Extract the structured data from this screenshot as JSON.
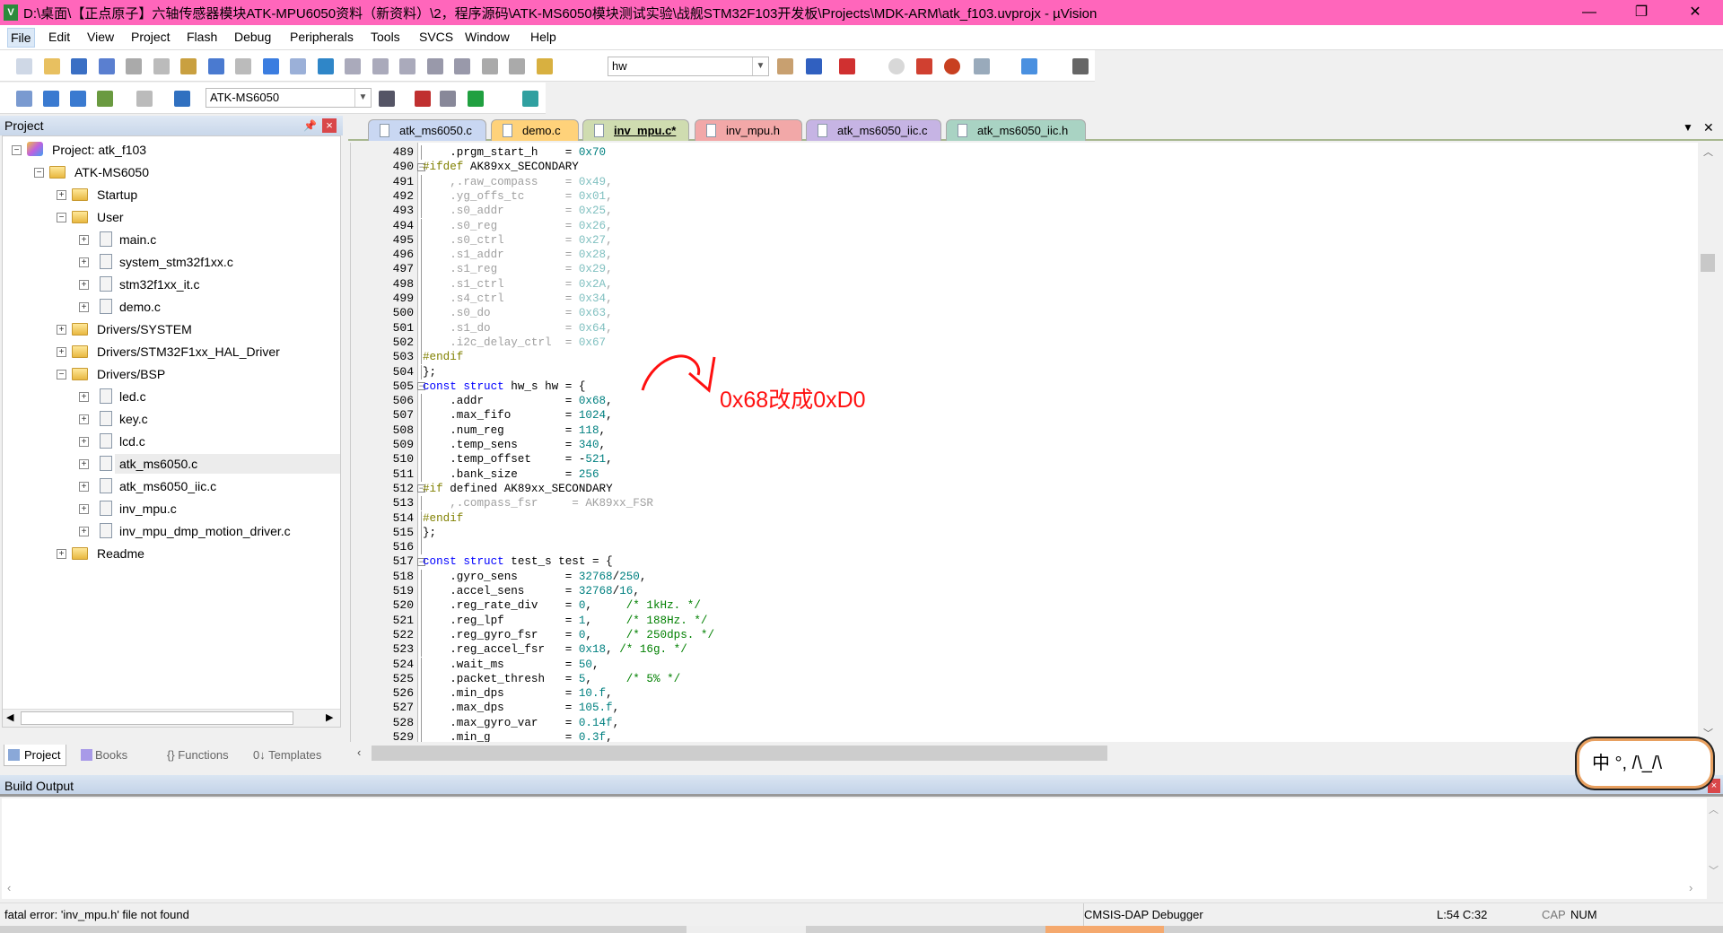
{
  "window": {
    "title": "D:\\桌面\\【正点原子】六轴传感器模块ATK-MPU6050资料（新资料）\\2，程序源码\\ATK-MS6050模块测试实验\\战舰STM32F103开发板\\Projects\\MDK-ARM\\atk_f103.uvprojx - µVision",
    "minimize": "—",
    "restore": "❐",
    "close": "✕"
  },
  "menu": [
    "File",
    "Edit",
    "View",
    "Project",
    "Flash",
    "Debug",
    "Peripherals",
    "Tools",
    "SVCS",
    "Window",
    "Help"
  ],
  "toolbar1": {
    "find_combo": "hw",
    "icons": [
      "new-file",
      "open",
      "save",
      "save-all",
      "cut",
      "copy",
      "paste",
      "undo",
      "redo",
      "nav-back",
      "nav-forward",
      "bookmark",
      "prev-bookmark",
      "next-bookmark",
      "clear-bookmarks",
      "indent",
      "unindent",
      "comment",
      "uncomment",
      "find-in-files"
    ],
    "icons2": [
      "incremental-find",
      "find-replace",
      "debug-start",
      "breakpoint",
      "breakpoint-disable",
      "breakpoint-kill",
      "breakpoint-all",
      "window-layout",
      "configure"
    ]
  },
  "toolbar2": {
    "target_combo": "ATK-MS6050",
    "icons": [
      "translate",
      "build",
      "rebuild",
      "batch-build",
      "stop-build",
      "download"
    ],
    "icons2": [
      "target-options",
      "manage-components",
      "select-packs",
      "pack-installer",
      "run-time-environment"
    ]
  },
  "project_panel": {
    "title": "Project",
    "pin": "pin-icon",
    "close": "×",
    "tree": [
      {
        "label": "Project: atk_f103",
        "level": 0,
        "type": "project",
        "expander": "−"
      },
      {
        "label": "ATK-MS6050",
        "level": 1,
        "type": "target",
        "expander": "−"
      },
      {
        "label": "Startup",
        "level": 2,
        "type": "folder",
        "expander": "+"
      },
      {
        "label": "User",
        "level": 2,
        "type": "folder-open",
        "expander": "−"
      },
      {
        "label": "main.c",
        "level": 3,
        "type": "file",
        "expander": "+"
      },
      {
        "label": "system_stm32f1xx.c",
        "level": 3,
        "type": "file",
        "expander": "+"
      },
      {
        "label": "stm32f1xx_it.c",
        "level": 3,
        "type": "file",
        "expander": "+"
      },
      {
        "label": "demo.c",
        "level": 3,
        "type": "file",
        "expander": "+"
      },
      {
        "label": "Drivers/SYSTEM",
        "level": 2,
        "type": "folder",
        "expander": "+"
      },
      {
        "label": "Drivers/STM32F1xx_HAL_Driver",
        "level": 2,
        "type": "folder",
        "expander": "+"
      },
      {
        "label": "Drivers/BSP",
        "level": 2,
        "type": "folder-open",
        "expander": "−"
      },
      {
        "label": "led.c",
        "level": 3,
        "type": "file",
        "expander": "+"
      },
      {
        "label": "key.c",
        "level": 3,
        "type": "file",
        "expander": "+"
      },
      {
        "label": "lcd.c",
        "level": 3,
        "type": "file",
        "expander": "+"
      },
      {
        "label": "atk_ms6050.c",
        "level": 3,
        "type": "file",
        "expander": "+",
        "selected": true
      },
      {
        "label": "atk_ms6050_iic.c",
        "level": 3,
        "type": "file",
        "expander": "+"
      },
      {
        "label": "inv_mpu.c",
        "level": 3,
        "type": "file",
        "expander": "+"
      },
      {
        "label": "inv_mpu_dmp_motion_driver.c",
        "level": 3,
        "type": "file",
        "expander": "+"
      },
      {
        "label": "Readme",
        "level": 2,
        "type": "folder",
        "expander": "+"
      }
    ],
    "tabs": [
      {
        "label": "Project",
        "active": true
      },
      {
        "label": "Books"
      },
      {
        "label": "{} Functions"
      },
      {
        "label": "0↓ Templates"
      }
    ]
  },
  "editor_tabs": [
    {
      "label": "atk_ms6050.c",
      "color": "#c9d7f2"
    },
    {
      "label": "demo.c",
      "color": "#ffd27a"
    },
    {
      "label": "inv_mpu.c*",
      "color": "#cfdcb0",
      "active": true
    },
    {
      "label": "inv_mpu.h",
      "color": "#f2a8a8"
    },
    {
      "label": "atk_ms6050_iic.c",
      "color": "#c6b4e4"
    },
    {
      "label": "atk_ms6050_iic.h",
      "color": "#a9d3c3"
    }
  ],
  "tab_controls": {
    "dropdown": "▼",
    "close": "✕"
  },
  "code": [
    {
      "n": 489,
      "t": [
        [
          "    .prgm_start_h    = ",
          ""
        ],
        [
          "0x70",
          "num"
        ]
      ]
    },
    {
      "n": 490,
      "fold": "−",
      "t": [
        [
          "#ifdef",
          "pp"
        ],
        [
          " AK89xx_SECONDARY",
          ""
        ]
      ]
    },
    {
      "n": 491,
      "t": [
        [
          "    ,.raw_compass    = ",
          "ina"
        ],
        [
          "0x49",
          "inan"
        ],
        [
          ",",
          "ina"
        ]
      ]
    },
    {
      "n": 492,
      "t": [
        [
          "    .yg_offs_tc      = ",
          "ina"
        ],
        [
          "0x01",
          "inan"
        ],
        [
          ",",
          "ina"
        ]
      ]
    },
    {
      "n": 493,
      "t": [
        [
          "    .s0_addr         = ",
          "ina"
        ],
        [
          "0x25",
          "inan"
        ],
        [
          ",",
          "ina"
        ]
      ]
    },
    {
      "n": 494,
      "t": [
        [
          "    .s0_reg          = ",
          "ina"
        ],
        [
          "0x26",
          "inan"
        ],
        [
          ",",
          "ina"
        ]
      ]
    },
    {
      "n": 495,
      "t": [
        [
          "    .s0_ctrl         = ",
          "ina"
        ],
        [
          "0x27",
          "inan"
        ],
        [
          ",",
          "ina"
        ]
      ]
    },
    {
      "n": 496,
      "t": [
        [
          "    .s1_addr         = ",
          "ina"
        ],
        [
          "0x28",
          "inan"
        ],
        [
          ",",
          "ina"
        ]
      ]
    },
    {
      "n": 497,
      "t": [
        [
          "    .s1_reg          = ",
          "ina"
        ],
        [
          "0x29",
          "inan"
        ],
        [
          ",",
          "ina"
        ]
      ]
    },
    {
      "n": 498,
      "t": [
        [
          "    .s1_ctrl         = ",
          "ina"
        ],
        [
          "0x2A",
          "inan"
        ],
        [
          ",",
          "ina"
        ]
      ]
    },
    {
      "n": 499,
      "t": [
        [
          "    .s4_ctrl         = ",
          "ina"
        ],
        [
          "0x34",
          "inan"
        ],
        [
          ",",
          "ina"
        ]
      ]
    },
    {
      "n": 500,
      "t": [
        [
          "    .s0_do           = ",
          "ina"
        ],
        [
          "0x63",
          "inan"
        ],
        [
          ",",
          "ina"
        ]
      ]
    },
    {
      "n": 501,
      "t": [
        [
          "    .s1_do           = ",
          "ina"
        ],
        [
          "0x64",
          "inan"
        ],
        [
          ",",
          "ina"
        ]
      ]
    },
    {
      "n": 502,
      "t": [
        [
          "    .i2c_delay_ctrl  = ",
          "ina"
        ],
        [
          "0x67",
          "inan"
        ]
      ]
    },
    {
      "n": 503,
      "t": [
        [
          "#endif",
          "pp"
        ]
      ]
    },
    {
      "n": 504,
      "t": [
        [
          "};",
          ""
        ]
      ]
    },
    {
      "n": 505,
      "fold": "−",
      "t": [
        [
          "const",
          "kw"
        ],
        [
          " ",
          ""
        ],
        [
          "struct",
          "kw"
        ],
        [
          " hw_s hw = {",
          ""
        ]
      ]
    },
    {
      "n": 506,
      "t": [
        [
          "    .addr            = ",
          ""
        ],
        [
          "0x68",
          "num"
        ],
        [
          ",",
          ""
        ]
      ]
    },
    {
      "n": 507,
      "t": [
        [
          "    .max_fifo        = ",
          ""
        ],
        [
          "1024",
          "num"
        ],
        [
          ",",
          ""
        ]
      ]
    },
    {
      "n": 508,
      "t": [
        [
          "    .num_reg         = ",
          ""
        ],
        [
          "118",
          "num"
        ],
        [
          ",",
          ""
        ]
      ]
    },
    {
      "n": 509,
      "t": [
        [
          "    .temp_sens       = ",
          ""
        ],
        [
          "340",
          "num"
        ],
        [
          ",",
          ""
        ]
      ]
    },
    {
      "n": 510,
      "t": [
        [
          "    .temp_offset     = -",
          ""
        ],
        [
          "521",
          "num"
        ],
        [
          ",",
          ""
        ]
      ]
    },
    {
      "n": 511,
      "t": [
        [
          "    .bank_size       = ",
          ""
        ],
        [
          "256",
          "num"
        ]
      ]
    },
    {
      "n": 512,
      "fold": "−",
      "t": [
        [
          "#if",
          "pp"
        ],
        [
          " defined AK89xx_SECONDARY",
          ""
        ]
      ]
    },
    {
      "n": 513,
      "t": [
        [
          "    ,.compass_fsr     = AK89xx_FSR",
          "ina"
        ]
      ]
    },
    {
      "n": 514,
      "t": [
        [
          "#endif",
          "pp"
        ]
      ]
    },
    {
      "n": 515,
      "t": [
        [
          "};",
          ""
        ]
      ]
    },
    {
      "n": 516,
      "t": []
    },
    {
      "n": 517,
      "fold": "−",
      "t": [
        [
          "const",
          "kw"
        ],
        [
          " ",
          ""
        ],
        [
          "struct",
          "kw"
        ],
        [
          " test_s test = {",
          ""
        ]
      ]
    },
    {
      "n": 518,
      "t": [
        [
          "    .gyro_sens       = ",
          ""
        ],
        [
          "32768",
          "num"
        ],
        [
          "/",
          ""
        ],
        [
          "250",
          "num"
        ],
        [
          ",",
          ""
        ]
      ]
    },
    {
      "n": 519,
      "t": [
        [
          "    .accel_sens      = ",
          ""
        ],
        [
          "32768",
          "num"
        ],
        [
          "/",
          ""
        ],
        [
          "16",
          "num"
        ],
        [
          ",",
          ""
        ]
      ]
    },
    {
      "n": 520,
      "t": [
        [
          "    .reg_rate_div    = ",
          ""
        ],
        [
          "0",
          "num"
        ],
        [
          ",     ",
          ""
        ],
        [
          "/* 1kHz. */",
          "cm"
        ]
      ]
    },
    {
      "n": 521,
      "t": [
        [
          "    .reg_lpf         = ",
          ""
        ],
        [
          "1",
          "num"
        ],
        [
          ",     ",
          ""
        ],
        [
          "/* 188Hz. */",
          "cm"
        ]
      ]
    },
    {
      "n": 522,
      "t": [
        [
          "    .reg_gyro_fsr    = ",
          ""
        ],
        [
          "0",
          "num"
        ],
        [
          ",     ",
          ""
        ],
        [
          "/* 250dps. */",
          "cm"
        ]
      ]
    },
    {
      "n": 523,
      "t": [
        [
          "    .reg_accel_fsr   = ",
          ""
        ],
        [
          "0x18",
          "num"
        ],
        [
          ", ",
          ""
        ],
        [
          "/* 16g. */",
          "cm"
        ]
      ]
    },
    {
      "n": 524,
      "t": [
        [
          "    .wait_ms         = ",
          ""
        ],
        [
          "50",
          "num"
        ],
        [
          ",",
          ""
        ]
      ]
    },
    {
      "n": 525,
      "t": [
        [
          "    .packet_thresh   = ",
          ""
        ],
        [
          "5",
          "num"
        ],
        [
          ",     ",
          ""
        ],
        [
          "/* 5% */",
          "cm"
        ]
      ]
    },
    {
      "n": 526,
      "t": [
        [
          "    .min_dps         = ",
          ""
        ],
        [
          "10.f",
          "num"
        ],
        [
          ",",
          ""
        ]
      ]
    },
    {
      "n": 527,
      "t": [
        [
          "    .max_dps         = ",
          ""
        ],
        [
          "105.f",
          "num"
        ],
        [
          ",",
          ""
        ]
      ]
    },
    {
      "n": 528,
      "t": [
        [
          "    .max_gyro_var    = ",
          ""
        ],
        [
          "0.14f",
          "num"
        ],
        [
          ",",
          ""
        ]
      ]
    },
    {
      "n": 529,
      "t": [
        [
          "    .min_g           = ",
          ""
        ],
        [
          "0.3f",
          "num"
        ],
        [
          ",",
          ""
        ]
      ]
    }
  ],
  "annotation": {
    "text": "0x68改成0xD0",
    "color": "#ff1010"
  },
  "ime_widget": {
    "text": "中 °, /\\_/\\"
  },
  "build_output": {
    "title": "Build Output"
  },
  "status": {
    "message": "fatal error: 'inv_mpu.h' file not found",
    "debugger": "CMSIS-DAP Debugger",
    "position": "L:54 C:32",
    "cap": "CAP",
    "num": "NUM"
  },
  "colors": {
    "titlebar": "#ff66bb",
    "number": "#008080",
    "keyword": "#0000ff",
    "preprocessor": "#808000",
    "comment": "#008000"
  }
}
